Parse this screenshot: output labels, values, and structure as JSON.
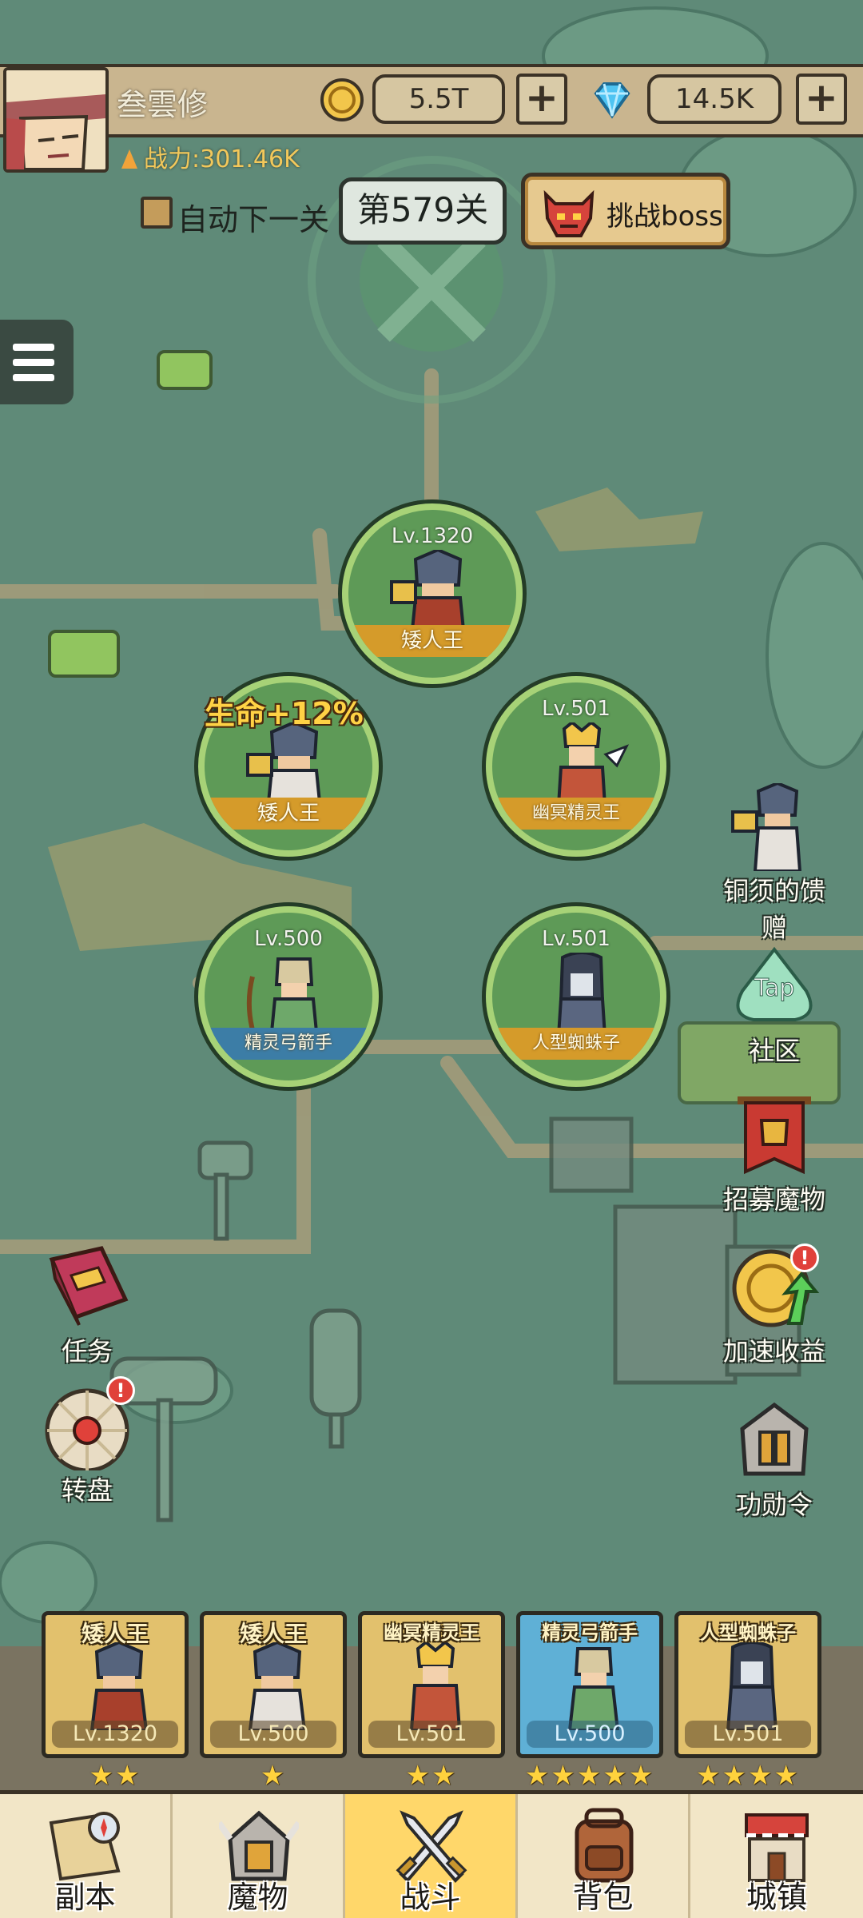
{
  "player": {
    "name": "叁雲修",
    "power": "战力:301.46K",
    "gold": "5.5T",
    "gems": "14.5K"
  },
  "stage_bar": {
    "auto_next": "自动下一关",
    "stage": "第579关",
    "challenge_boss": "挑战boss"
  },
  "formation": [
    {
      "level": "Lv.1320",
      "name": "矮人王"
    },
    {
      "level": "",
      "name": "矮人王",
      "buff": "生命+12%"
    },
    {
      "level": "Lv.501",
      "name": "幽冥精灵王"
    },
    {
      "level": "Lv.500",
      "name": "精灵弓箭手"
    },
    {
      "level": "Lv.501",
      "name": "人型蜘蛛子"
    }
  ],
  "side_right": [
    {
      "label": "铜须的馈赠",
      "icon": "dwarf-gift-icon"
    },
    {
      "label": "社区",
      "icon": "tap-community-icon",
      "icon_text": "Tap"
    },
    {
      "label": "招募魔物",
      "icon": "recruit-banner-icon"
    },
    {
      "label": "加速收益",
      "icon": "speed-income-icon",
      "badge": "!"
    },
    {
      "label": "功勋令",
      "icon": "helmet-order-icon"
    }
  ],
  "side_left": [
    {
      "label": "任务",
      "icon": "quest-book-icon"
    },
    {
      "label": "转盘",
      "icon": "wheel-icon",
      "badge": "!"
    }
  ],
  "team": [
    {
      "name": "矮人王",
      "level": "Lv.1320",
      "stars": "★★"
    },
    {
      "name": "矮人王",
      "level": "Lv.500",
      "stars": "★"
    },
    {
      "name": "幽冥精灵王",
      "level": "Lv.501",
      "stars": "★★"
    },
    {
      "name": "精灵弓箭手",
      "level": "Lv.500",
      "stars": "★★★★★"
    },
    {
      "name": "人型蜘蛛子",
      "level": "Lv.501",
      "stars": "★★★★"
    }
  ],
  "nav": [
    {
      "label": "副本",
      "icon": "map-compass-icon"
    },
    {
      "label": "魔物",
      "icon": "monster-helmet-icon"
    },
    {
      "label": "战斗",
      "icon": "crossed-swords-icon",
      "active": true
    },
    {
      "label": "背包",
      "icon": "backpack-icon"
    },
    {
      "label": "城镇",
      "icon": "town-shop-icon"
    }
  ],
  "colors": {
    "map_green": "#5f8a78",
    "hero_ring": "#a7d277",
    "ribbon_gold": "#d59b2a",
    "nav_active": "#ffd76a",
    "star_gold": "#ffd23d"
  }
}
